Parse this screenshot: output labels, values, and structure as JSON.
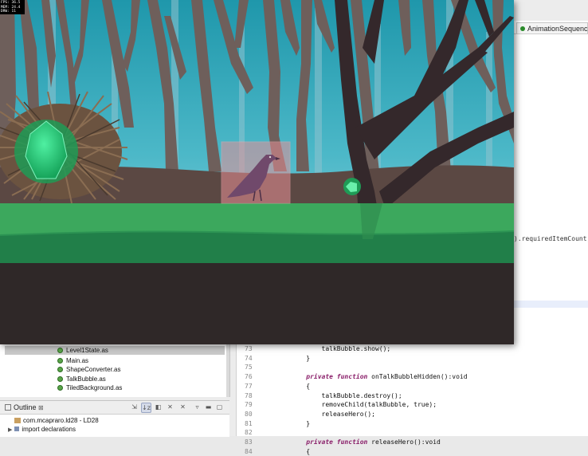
{
  "debug": {
    "fps_label": "FPS: 36.5",
    "mem_label": "MEM: 24.4",
    "drw_label": "DRW: 11"
  },
  "editor_tab": {
    "label": "AnimationSequence.as"
  },
  "partial_code": ").requiredItemCount)",
  "files": [
    {
      "name": "Level1State.as",
      "selected": true
    },
    {
      "name": "Main.as",
      "selected": false
    },
    {
      "name": "ShapeConverter.as",
      "selected": false
    },
    {
      "name": "TalkBubble.as",
      "selected": false
    },
    {
      "name": "TiledBackground.as",
      "selected": false
    }
  ],
  "outline": {
    "tab_label": "Outline",
    "class_row": "com.mcapraro.ld28 - LD28",
    "imports_row": "import declarations"
  },
  "code_lines": [
    {
      "num": "73",
      "text": "        talkBubble.show();"
    },
    {
      "num": "74",
      "text": "    }"
    },
    {
      "num": "75",
      "text": ""
    },
    {
      "num": "76",
      "text": "    private function onTalkBubbleHidden():void"
    },
    {
      "num": "77",
      "text": "    {"
    },
    {
      "num": "78",
      "text": "        talkBubble.destroy();"
    },
    {
      "num": "79",
      "text": "        removeChild(talkBubble, true);"
    },
    {
      "num": "80",
      "text": "        releaseHero();"
    },
    {
      "num": "81",
      "text": "    }"
    },
    {
      "num": "82",
      "text": ""
    },
    {
      "num": "83",
      "text": "    private function releaseHero():void"
    },
    {
      "num": "84",
      "text": "    {"
    }
  ],
  "colors": {
    "sky_top": "#2a9fb2",
    "sky_bottom": "#a8d6e2",
    "tree": "#6c5a55",
    "tree_dark": "#33272a",
    "ground_brown": "#5c4944",
    "grass_light": "#3aa55a",
    "grass_dark": "#1f7c47",
    "soil": "#2f2727",
    "gem": "#2fcf7a",
    "bird": "#6f4a6a",
    "highlight_box": "#e88f95"
  }
}
